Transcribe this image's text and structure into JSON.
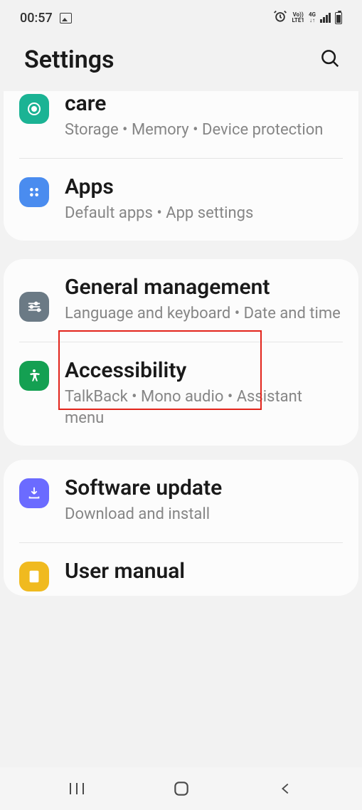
{
  "status": {
    "time": "00:57",
    "net_line1": "Vo))",
    "net_line2": "LTE1",
    "net_gen": "4G",
    "arrows": "↓↑"
  },
  "header": {
    "title": "Settings"
  },
  "items": {
    "care": {
      "title": "care",
      "subtitle": "Storage  •  Memory  •  Device protection"
    },
    "apps": {
      "title": "Apps",
      "subtitle": "Default apps  •  App settings"
    },
    "gm": {
      "title": "General management",
      "subtitle": "Language and keyboard  •  Date and time"
    },
    "a11y": {
      "title": "Accessibility",
      "subtitle": "TalkBack  •  Mono audio  •  Assistant menu"
    },
    "update": {
      "title": "Software update",
      "subtitle": "Download and install"
    },
    "manual": {
      "title": "User manual"
    }
  }
}
